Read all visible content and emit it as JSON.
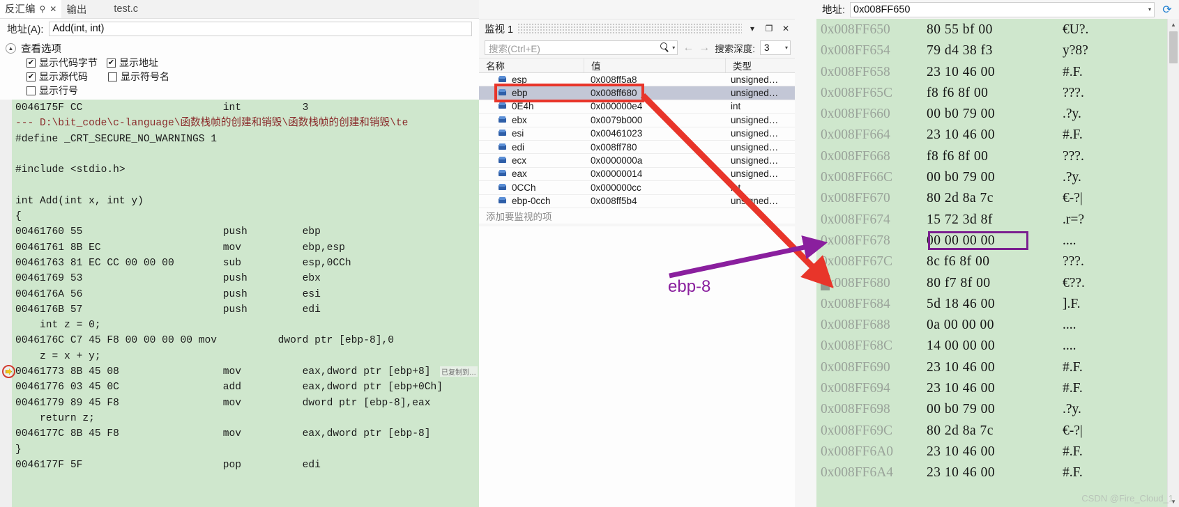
{
  "disassembly": {
    "tabs": [
      {
        "label": "反汇编",
        "active": true,
        "pin": "⚲",
        "close": "✕"
      },
      {
        "label": "输出",
        "active": false
      },
      {
        "label": "test.c",
        "active": false
      }
    ],
    "address_label": "地址(A):",
    "address_value": "Add(int, int)",
    "view_options_title": "查看选项",
    "options": [
      {
        "label": "显示代码字节",
        "checked": true
      },
      {
        "label": "显示地址",
        "checked": true
      },
      {
        "label": "显示源代码",
        "checked": true
      },
      {
        "label": "显示符号名",
        "checked": false
      },
      {
        "label": "显示行号",
        "checked": false
      }
    ],
    "tooltip_note": "已复制到…",
    "lines": [
      {
        "kind": "asm",
        "text": "0046175F CC                       int          3"
      },
      {
        "kind": "path",
        "text": "--- D:\\bit_code\\c-language\\函数栈帧的创建和销毁\\函数栈帧的创建和销毁\\te"
      },
      {
        "kind": "src",
        "text": "#define _CRT_SECURE_NO_WARNINGS 1"
      },
      {
        "kind": "src",
        "text": ""
      },
      {
        "kind": "src",
        "text": "#include <stdio.h>"
      },
      {
        "kind": "src",
        "text": ""
      },
      {
        "kind": "src",
        "text": "int Add(int x, int y)"
      },
      {
        "kind": "src",
        "text": "{"
      },
      {
        "kind": "asm",
        "text": "00461760 55                       push         ebp"
      },
      {
        "kind": "asm",
        "text": "00461761 8B EC                    mov          ebp,esp"
      },
      {
        "kind": "asm",
        "text": "00461763 81 EC CC 00 00 00        sub          esp,0CCh"
      },
      {
        "kind": "asm",
        "text": "00461769 53                       push         ebx"
      },
      {
        "kind": "asm",
        "text": "0046176A 56                       push         esi"
      },
      {
        "kind": "asm",
        "text": "0046176B 57                       push         edi"
      },
      {
        "kind": "src",
        "text": "    int z = 0;"
      },
      {
        "kind": "asm",
        "text": "0046176C C7 45 F8 00 00 00 00 mov          dword ptr [ebp-8],0"
      },
      {
        "kind": "src",
        "text": "    z = x + y;"
      },
      {
        "kind": "asm",
        "current": true,
        "text": "00461773 8B 45 08                 mov          eax,dword ptr [ebp+8]"
      },
      {
        "kind": "asm",
        "text": "00461776 03 45 0C                 add          eax,dword ptr [ebp+0Ch]"
      },
      {
        "kind": "asm",
        "text": "00461779 89 45 F8                 mov          dword ptr [ebp-8],eax"
      },
      {
        "kind": "src",
        "text": "    return z;"
      },
      {
        "kind": "asm",
        "text": "0046177C 8B 45 F8                 mov          eax,dword ptr [ebp-8]"
      },
      {
        "kind": "src",
        "text": "}"
      },
      {
        "kind": "asm",
        "text": "0046177F 5F                       pop          edi"
      }
    ]
  },
  "watch": {
    "title": "监视 1",
    "window_buttons": {
      "dropdown": "▾",
      "maximize": "❐",
      "close": "✕"
    },
    "search_placeholder": "搜索(Ctrl+E)",
    "search_value": "",
    "nav_back": "←",
    "nav_forward": "→",
    "depth_label": "搜索深度:",
    "depth_value": "3",
    "columns": [
      "名称",
      "值",
      "类型"
    ],
    "rows": [
      {
        "name": "esp",
        "value": "0x008ff5a8",
        "type": "unsigned…",
        "selected": false
      },
      {
        "name": "ebp",
        "value": "0x008ff680",
        "type": "unsigned…",
        "selected": true
      },
      {
        "name": "0E4h",
        "value": "0x000000e4",
        "type": "int",
        "selected": false
      },
      {
        "name": "ebx",
        "value": "0x0079b000",
        "type": "unsigned…",
        "selected": false
      },
      {
        "name": "esi",
        "value": "0x00461023",
        "type": "unsigned…",
        "selected": false
      },
      {
        "name": "edi",
        "value": "0x008ff780",
        "type": "unsigned…",
        "selected": false
      },
      {
        "name": "ecx",
        "value": "0x0000000a",
        "type": "unsigned…",
        "selected": false
      },
      {
        "name": "eax",
        "value": "0x00000014",
        "type": "unsigned…",
        "selected": false
      },
      {
        "name": "0CCh",
        "value": "0x000000cc",
        "type": "int",
        "selected": false
      },
      {
        "name": "ebp-0cch",
        "value": "0x008ff5b4",
        "type": "unsigned…",
        "selected": false
      }
    ],
    "add_item_text": "添加要监视的项"
  },
  "memory": {
    "address_label": "地址:",
    "address_value": "0x008FF650",
    "refresh_icon": "⟳",
    "dropdown_icon": "▾",
    "rows": [
      {
        "addr": "0x008FF650",
        "hex": "80 55 bf 00",
        "ascii": "€U?."
      },
      {
        "addr": "0x008FF654",
        "hex": "79 d4 38 f3",
        "ascii": "y?8?"
      },
      {
        "addr": "0x008FF658",
        "hex": "23 10 46 00",
        "ascii": "#.F."
      },
      {
        "addr": "0x008FF65C",
        "hex": "f8 f6 8f 00",
        "ascii": "???."
      },
      {
        "addr": "0x008FF660",
        "hex": "00 b0 79 00",
        "ascii": ".?y."
      },
      {
        "addr": "0x008FF664",
        "hex": "23 10 46 00",
        "ascii": "#.F."
      },
      {
        "addr": "0x008FF668",
        "hex": "f8 f6 8f 00",
        "ascii": "???."
      },
      {
        "addr": "0x008FF66C",
        "hex": "00 b0 79 00",
        "ascii": ".?y."
      },
      {
        "addr": "0x008FF670",
        "hex": "80 2d 8a 7c",
        "ascii": "€-?|"
      },
      {
        "addr": "0x008FF674",
        "hex": "15 72 3d 8f",
        "ascii": ".r=?"
      },
      {
        "addr": "0x008FF678",
        "hex": "00 00 00 00",
        "ascii": "....",
        "boxed": true
      },
      {
        "addr": "0x008FF67C",
        "hex": "8c f6 8f 00",
        "ascii": "???."
      },
      {
        "addr": "0x008FF680",
        "hex": "80 f7 8f 00",
        "ascii": "€??.",
        "cursor": true
      },
      {
        "addr": "0x008FF684",
        "hex": "5d 18 46 00",
        "ascii": "].F."
      },
      {
        "addr": "0x008FF688",
        "hex": "0a 00 00 00",
        "ascii": "...."
      },
      {
        "addr": "0x008FF68C",
        "hex": "14 00 00 00",
        "ascii": "...."
      },
      {
        "addr": "0x008FF690",
        "hex": "23 10 46 00",
        "ascii": "#.F."
      },
      {
        "addr": "0x008FF694",
        "hex": "23 10 46 00",
        "ascii": "#.F."
      },
      {
        "addr": "0x008FF698",
        "hex": "00 b0 79 00",
        "ascii": ".?y."
      },
      {
        "addr": "0x008FF69C",
        "hex": "80 2d 8a 7c",
        "ascii": "€-?|"
      },
      {
        "addr": "0x008FF6A0",
        "hex": "23 10 46 00",
        "ascii": "#.F."
      },
      {
        "addr": "0x008FF6A4",
        "hex": "23 10 46 00",
        "ascii": "#.F."
      }
    ]
  },
  "annotations": {
    "label_ebp8": "ebp-8",
    "red_color": "#e8352a",
    "purple_color": "#8a1f9e"
  },
  "watermark": "CSDN @Fire_Cloud_1"
}
